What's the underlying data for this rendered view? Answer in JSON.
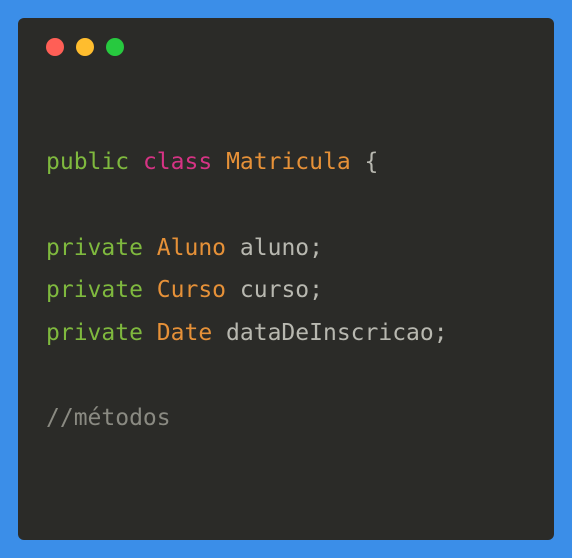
{
  "titlebar": {
    "dots": [
      "close",
      "minimize",
      "maximize"
    ]
  },
  "code": {
    "line1": {
      "kw_public": "public",
      "kw_class": "class",
      "classname": "Matricula",
      "brace": " {"
    },
    "field1": {
      "kw_private": "private",
      "type": "Aluno",
      "name": "aluno",
      "semi": ";"
    },
    "field2": {
      "kw_private": "private",
      "type": "Curso",
      "name": "curso",
      "semi": ";"
    },
    "field3": {
      "kw_private": "private",
      "type": "Date",
      "name": "dataDeInscricao",
      "semi": ";"
    },
    "comment": "//métodos"
  }
}
